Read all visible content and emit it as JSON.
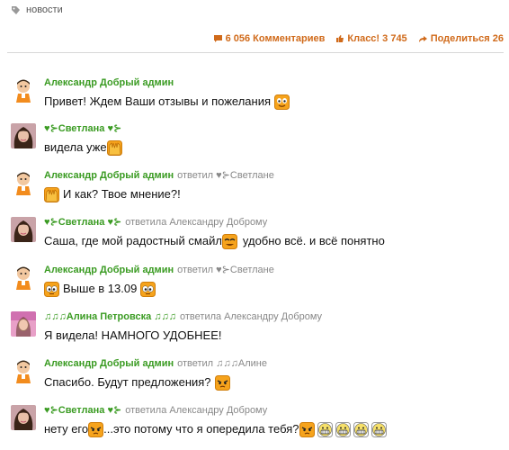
{
  "tag": {
    "label": "новости"
  },
  "stats": {
    "comments": "6 056 Комментариев",
    "likes": "Класс! 3 745",
    "share": "Поделиться 26"
  },
  "colors": {
    "accent": "#d06a1a",
    "author": "#3a9b22",
    "meta": "#888888"
  },
  "comments": [
    {
      "author": "Александр Добрый админ",
      "reply": "",
      "avatar": "cartoon-boy",
      "parts": [
        "Привет! Ждем Ваши отзывы и пожелания",
        ""
      ]
    },
    {
      "author": "♥⊱Светлана ♥⊱",
      "reply": "",
      "avatar": "girl-photo",
      "parts": [
        "видела уже"
      ]
    },
    {
      "author": "Александр Добрый админ",
      "reply": "ответил ♥⊱Светлане",
      "avatar": "cartoon-boy",
      "parts": [
        "И как? Твое мнение?!"
      ]
    },
    {
      "author": "♥⊱Светлана ♥⊱",
      "reply": "ответила Александру Доброму",
      "avatar": "girl-photo",
      "parts": [
        "Саша, где мой радостный смайл",
        "удобно всё. и всё понятно"
      ]
    },
    {
      "author": "Александр Добрый админ",
      "reply": "ответил ♥⊱Светлане",
      "avatar": "cartoon-boy",
      "parts": [
        "Выше в 13.09"
      ]
    },
    {
      "author": "♫♫♫Алина Петровска ♫♫♫",
      "reply": "ответила Александру Доброму",
      "avatar": "pink-photo",
      "parts": [
        "Я видела! НАМНОГО УДОБНЕЕ!"
      ]
    },
    {
      "author": "Александр Добрый админ",
      "reply": "ответил ♫♫♫Алине",
      "avatar": "cartoon-boy",
      "parts": [
        "Спасибо. Будут предложения?"
      ]
    },
    {
      "author": "♥⊱Светлана ♥⊱",
      "reply": "ответила Александру Доброму",
      "avatar": "girl-photo",
      "parts": [
        "нету его",
        "...это потому что я опередила тебя?"
      ]
    }
  ]
}
